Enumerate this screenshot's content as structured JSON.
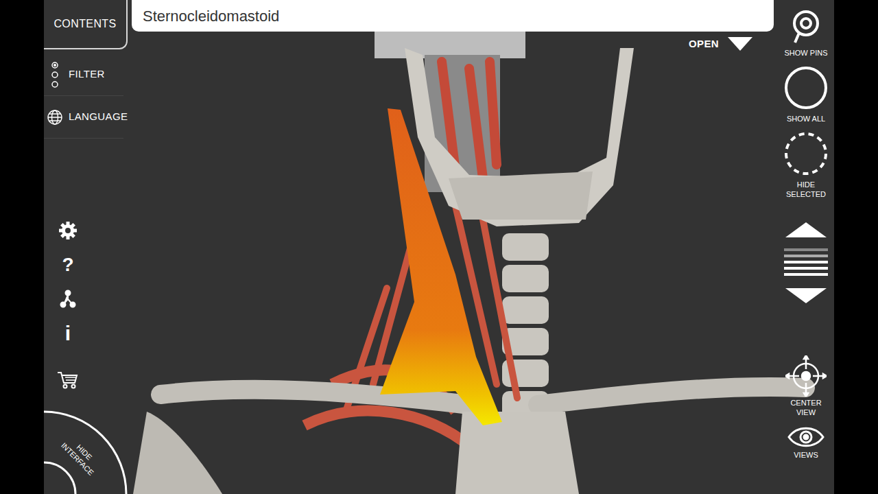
{
  "search": {
    "value": "Sternocleidomastoid"
  },
  "left_panel": {
    "contents": "CONTENTS",
    "items": [
      {
        "label": "FILTER"
      },
      {
        "label": "LANGUAGE"
      }
    ]
  },
  "tools": {
    "help": "?",
    "info": "i"
  },
  "hide_interface": "HIDE INTERFACE",
  "open": {
    "label": "OPEN"
  },
  "right_tools": [
    {
      "kind": "pins",
      "label": "SHOW PINS"
    },
    {
      "kind": "circle",
      "label": "SHOW ALL"
    },
    {
      "kind": "dashed",
      "label": "HIDE SELECTED"
    }
  ],
  "bottom_tools": [
    {
      "kind": "center",
      "label": "CENTER VIEW"
    },
    {
      "kind": "eye",
      "label": "VIEWS"
    }
  ]
}
